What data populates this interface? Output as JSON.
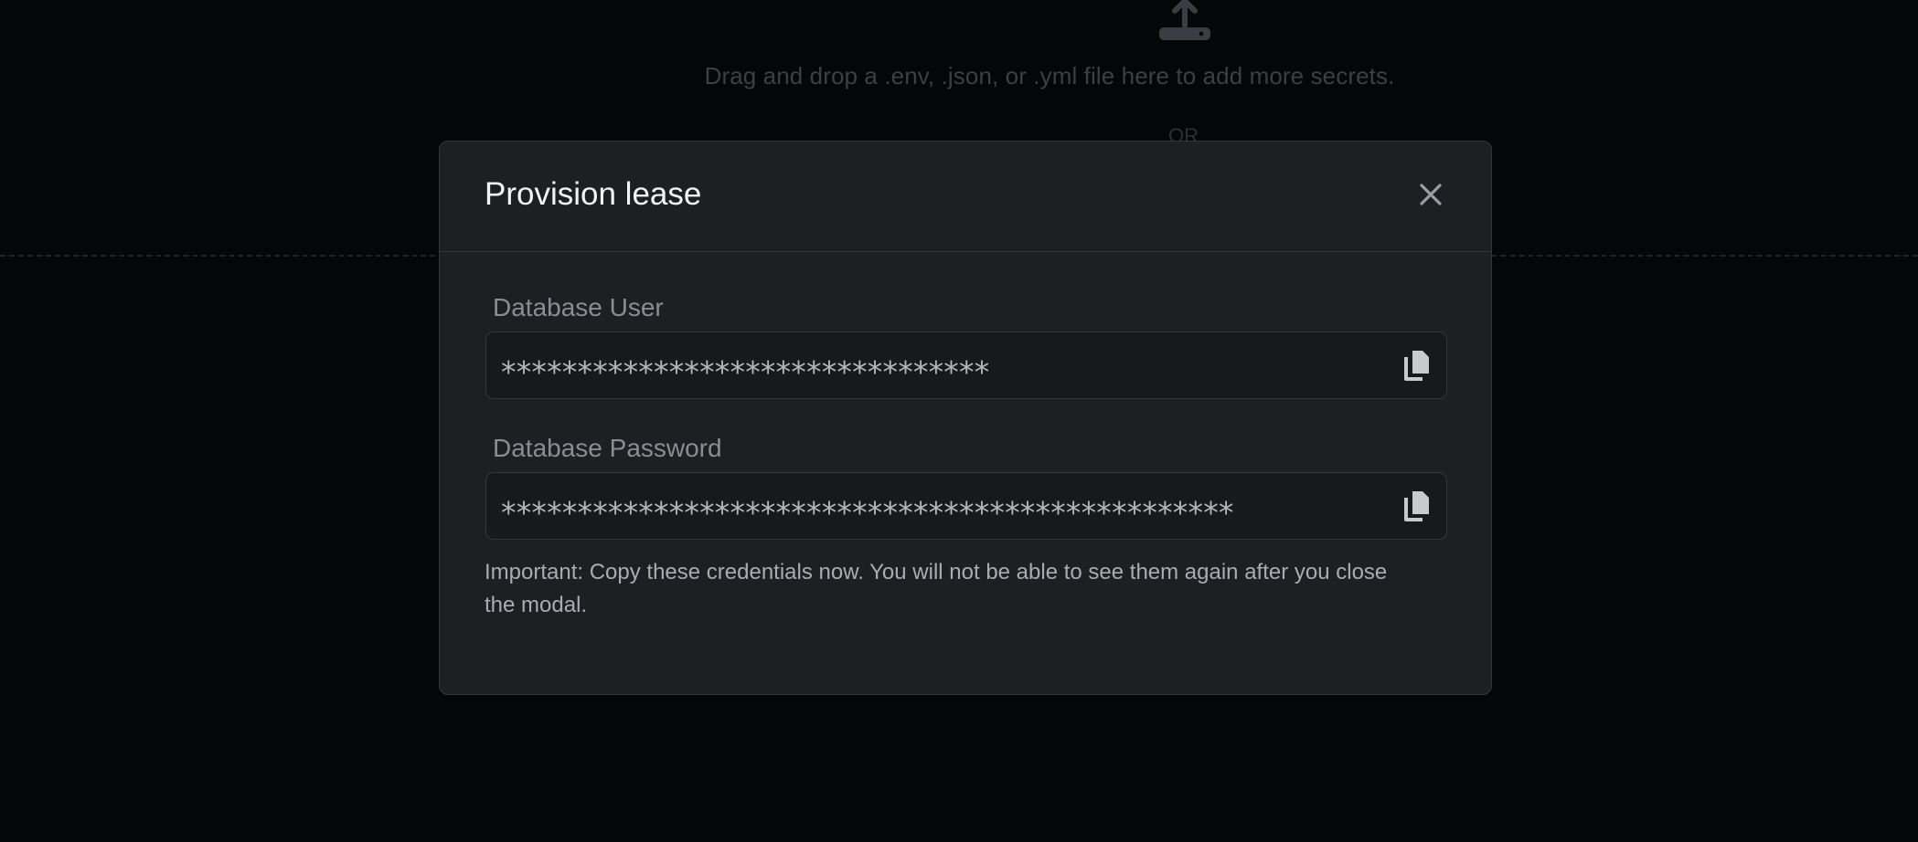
{
  "background": {
    "upload_icon": "upload-icon",
    "drop_text": "Drag and drop a .env, .json, or .yml file here to add more secrets.",
    "or_text": "OR"
  },
  "modal": {
    "title": "Provision lease",
    "close_icon": "close-icon",
    "fields": [
      {
        "label": "Database User",
        "value": "********************************",
        "copy_icon": "copy-icon"
      },
      {
        "label": "Database Password",
        "value": "************************************************",
        "copy_icon": "copy-icon"
      }
    ],
    "note": "Important: Copy these credentials now. You will not be able to see them again after you close the modal."
  },
  "colors": {
    "page_background": "#050607",
    "modal_background": "#1e1f22",
    "field_background": "#18191b",
    "border": "#34363a",
    "title_text": "#f2f3f5",
    "label_text": "#8a8d92",
    "value_text": "#b4b6ba"
  }
}
